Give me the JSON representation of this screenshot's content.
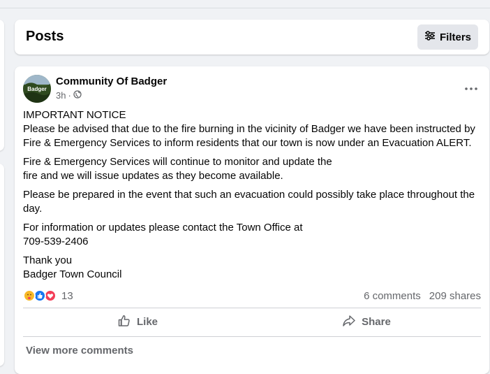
{
  "posts_header": {
    "title": "Posts",
    "filters_label": "Filters"
  },
  "post": {
    "page_name": "Community Of Badger",
    "avatar_text": "Badger",
    "time": "3h",
    "visibility_icon": "globe-icon",
    "more_icon": "more-dots-icon",
    "paragraphs": [
      {
        "lines": [
          "IMPORTANT NOTICE",
          "Please be advised that due to the fire burning in the vicinity of Badger we have been instructed by",
          "Fire & Emergency Services to inform residents that our town is now under an Evacuation ALERT."
        ]
      },
      {
        "lines": [
          "Fire & Emergency Services will continue to monitor and update the",
          "fire and we will issue updates as they become available."
        ]
      },
      {
        "lines": [
          "Please be prepared in the event that such an evacuation could possibly take place throughout the",
          "day."
        ]
      },
      {
        "lines": [
          "For information or updates please contact the Town Office at",
          "709-539-2406"
        ]
      },
      {
        "lines": [
          "Thank you",
          "Badger Town Council"
        ]
      }
    ],
    "reactions": {
      "icons": [
        "care-reaction-icon",
        "like-reaction-icon",
        "love-reaction-icon"
      ],
      "count": "13",
      "comments": "6 comments",
      "shares": "209 shares"
    },
    "actions": {
      "like_label": "Like",
      "share_label": "Share"
    },
    "view_more_comments": "View more comments"
  },
  "colors": {
    "background": "#f0f2f5",
    "card": "#ffffff",
    "secondary_text": "#65676b",
    "like_blue": "#1877f2",
    "love_red": "#f33e58",
    "care_yellow": "#f7b928"
  }
}
